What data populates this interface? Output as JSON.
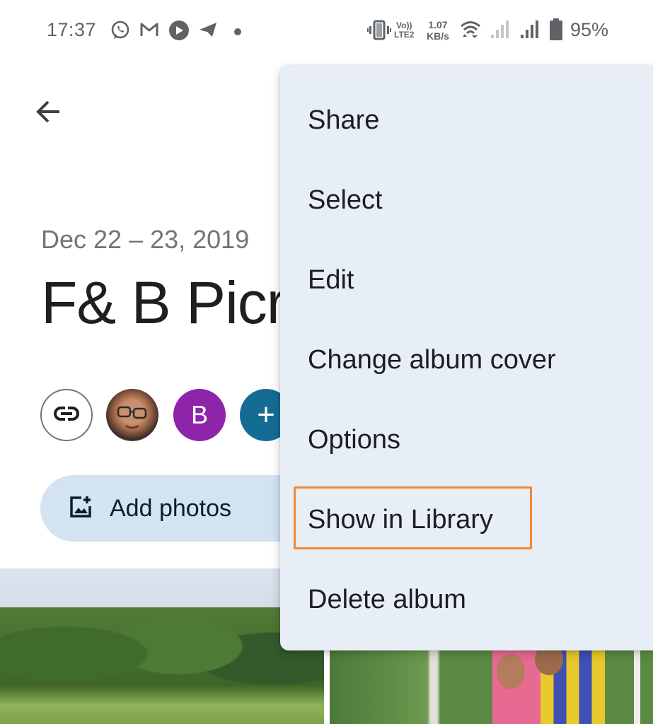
{
  "status_bar": {
    "time": "17:37",
    "notification_icons": [
      "whatsapp-icon",
      "gmail-icon",
      "youtube-play-icon",
      "telegram-icon",
      "more-dot-icon"
    ],
    "network_label_top": "Vo))",
    "network_label_bottom": "LTE2",
    "speed_value": "1.07",
    "speed_unit": "KB/s",
    "system_icons": [
      "vibrate-icon",
      "volte-icon",
      "wifi-icon",
      "signal-sim1-icon",
      "signal-sim2-icon",
      "battery-icon"
    ],
    "battery_percent": "95%"
  },
  "header": {
    "back_icon": "arrow-back-icon"
  },
  "album": {
    "date_range": "Dec 22 – 23, 2019",
    "title": "F& B Picr",
    "share": {
      "link_icon": "link-icon",
      "avatars": [
        {
          "type": "photo",
          "label": "user-photo"
        },
        {
          "type": "initial",
          "label": "B",
          "color": "#8e24aa"
        }
      ],
      "add_person_label": "+",
      "add_person_color": "#146c94"
    },
    "add_photos_label": "Add photos"
  },
  "menu": {
    "items": [
      {
        "label": "Share"
      },
      {
        "label": "Select"
      },
      {
        "label": "Edit"
      },
      {
        "label": "Change album cover"
      },
      {
        "label": "Options"
      },
      {
        "label": "Show in Library",
        "highlighted": true
      },
      {
        "label": "Delete album"
      }
    ],
    "highlight_color": "#f08a34",
    "background": "#e8eef6"
  },
  "photos": [
    {
      "description": "park with palm trees"
    },
    {
      "description": "couple smiling"
    }
  ]
}
